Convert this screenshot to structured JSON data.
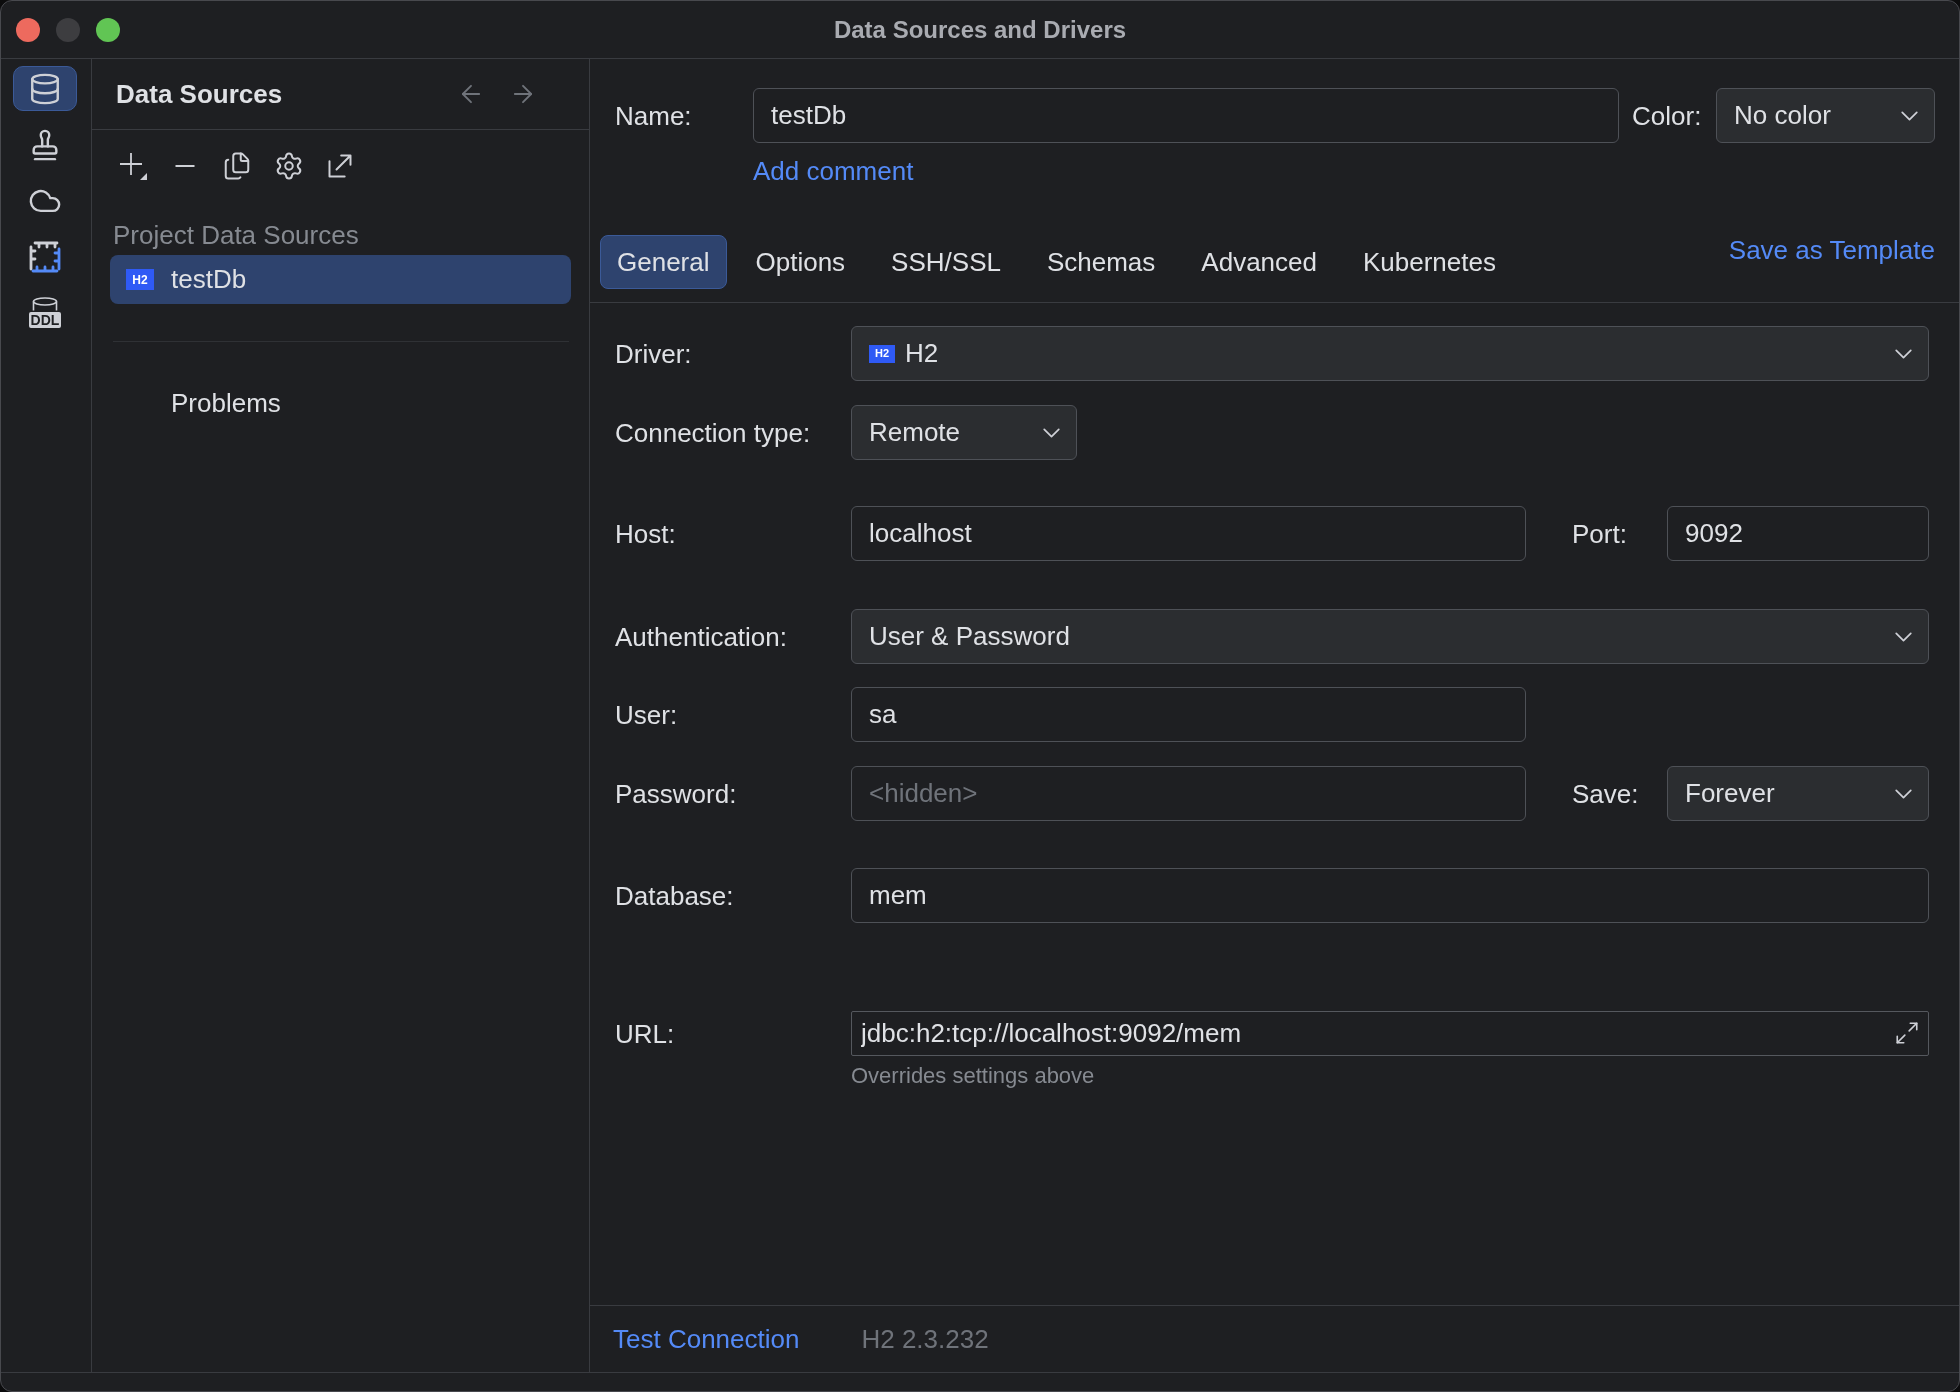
{
  "window": {
    "title": "Data Sources and Drivers",
    "controls": [
      {
        "kind": "close",
        "disabled": false
      },
      {
        "kind": "minimize",
        "disabled": true
      },
      {
        "kind": "zoom",
        "disabled": false
      }
    ]
  },
  "tool_strip": [
    {
      "kind": "database",
      "selected": true
    },
    {
      "kind": "stamp",
      "selected": false
    },
    {
      "kind": "cloud",
      "selected": false
    },
    {
      "kind": "schema",
      "selected": false
    },
    {
      "kind": "ddl",
      "selected": false,
      "label": "DDL"
    }
  ],
  "data_sources": {
    "title": "Data Sources",
    "nav": [
      {
        "kind": "back",
        "disabled": true
      },
      {
        "kind": "forward",
        "disabled": true
      }
    ],
    "group": "Project Data Sources",
    "items": [
      {
        "name": "testDb",
        "logo": "H2",
        "selected": true
      }
    ],
    "problems": "Problems"
  },
  "editor": {
    "name": {
      "label": "Name:",
      "value": "testDb"
    },
    "color": {
      "label": "Color:",
      "value": "No color"
    },
    "add_comment": "Add comment",
    "tabs": [
      {
        "label": "General",
        "selected": true
      },
      {
        "label": "Options",
        "selected": false
      },
      {
        "label": "SSH/SSL",
        "selected": false
      },
      {
        "label": "Schemas",
        "selected": false
      },
      {
        "label": "Advanced",
        "selected": false
      },
      {
        "label": "Kubernetes",
        "selected": false
      }
    ],
    "save_as_template": "Save as Template",
    "driver": {
      "label": "Driver:",
      "logo": "H2",
      "value": "H2"
    },
    "connection_type": {
      "label": "Connection type:",
      "value": "Remote"
    },
    "host": {
      "label": "Host:",
      "value": "localhost"
    },
    "port": {
      "label": "Port:",
      "value": "9092"
    },
    "authentication": {
      "label": "Authentication:",
      "value": "User & Password"
    },
    "user": {
      "label": "User:",
      "value": "sa"
    },
    "password": {
      "label": "Password:",
      "placeholder": "<hidden>"
    },
    "save": {
      "label": "Save:",
      "value": "Forever"
    },
    "database": {
      "label": "Database:",
      "value": "mem"
    },
    "url": {
      "label": "URL:",
      "value": "jdbc:h2:tcp://localhost:9092/mem",
      "hint": "Overrides settings above"
    },
    "test_connection": "Test Connection",
    "driver_version": "H2 2.3.232"
  }
}
